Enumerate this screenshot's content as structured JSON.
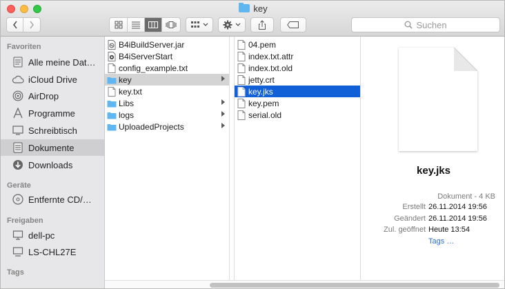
{
  "window": {
    "title": "key"
  },
  "toolbar": {
    "search_placeholder": "Suchen"
  },
  "sidebar": {
    "sections": [
      {
        "heading": "Favoriten"
      },
      {
        "heading": "Geräte"
      },
      {
        "heading": "Freigaben"
      },
      {
        "heading": "Tags"
      }
    ],
    "favorites": [
      {
        "label": "Alle meine Dat…",
        "icon": "all-files-icon"
      },
      {
        "label": "iCloud Drive",
        "icon": "cloud-icon"
      },
      {
        "label": "AirDrop",
        "icon": "airdrop-icon"
      },
      {
        "label": "Programme",
        "icon": "applications-icon"
      },
      {
        "label": "Schreibtisch",
        "icon": "desktop-icon"
      },
      {
        "label": "Dokumente",
        "icon": "documents-icon",
        "selected": true
      },
      {
        "label": "Downloads",
        "icon": "downloads-icon"
      }
    ],
    "devices": [
      {
        "label": "Entfernte CD/…",
        "icon": "disc-icon"
      }
    ],
    "shared": [
      {
        "label": "dell-pc",
        "icon": "pc-icon"
      },
      {
        "label": "LS-CHL27E",
        "icon": "nas-icon"
      }
    ]
  },
  "column1": [
    {
      "name": "B4iBuildServer.jar",
      "kind": "jar"
    },
    {
      "name": "B4iServerStart",
      "kind": "script"
    },
    {
      "name": "config_example.txt",
      "kind": "doc"
    },
    {
      "name": "key",
      "kind": "folder",
      "state": "parent-selected"
    },
    {
      "name": "key.txt",
      "kind": "doc"
    },
    {
      "name": "Libs",
      "kind": "folder"
    },
    {
      "name": "logs",
      "kind": "folder"
    },
    {
      "name": "UploadedProjects",
      "kind": "folder"
    }
  ],
  "column2": [
    {
      "name": "04.pem",
      "kind": "doc"
    },
    {
      "name": "index.txt.attr",
      "kind": "doc"
    },
    {
      "name": "index.txt.old",
      "kind": "doc"
    },
    {
      "name": "jetty.crt",
      "kind": "doc"
    },
    {
      "name": "key.jks",
      "kind": "doc",
      "state": "selected"
    },
    {
      "name": "key.pem",
      "kind": "doc"
    },
    {
      "name": "serial.old",
      "kind": "doc"
    }
  ],
  "preview": {
    "filename": "key.jks",
    "kind": "Dokument - 4 KB",
    "rows": [
      {
        "label": "Erstellt",
        "value": "26.11.2014 19:56"
      },
      {
        "label": "Geändert",
        "value": "26.11.2014 19:56"
      },
      {
        "label": "Zul. geöffnet",
        "value": "Heute 13:54"
      }
    ],
    "tags_link": "Tags …"
  },
  "colors": {
    "selection_blue": "#1160d8",
    "folder_blue": "#5fb6f0",
    "sidebar_bg": "#e7e7e9"
  }
}
